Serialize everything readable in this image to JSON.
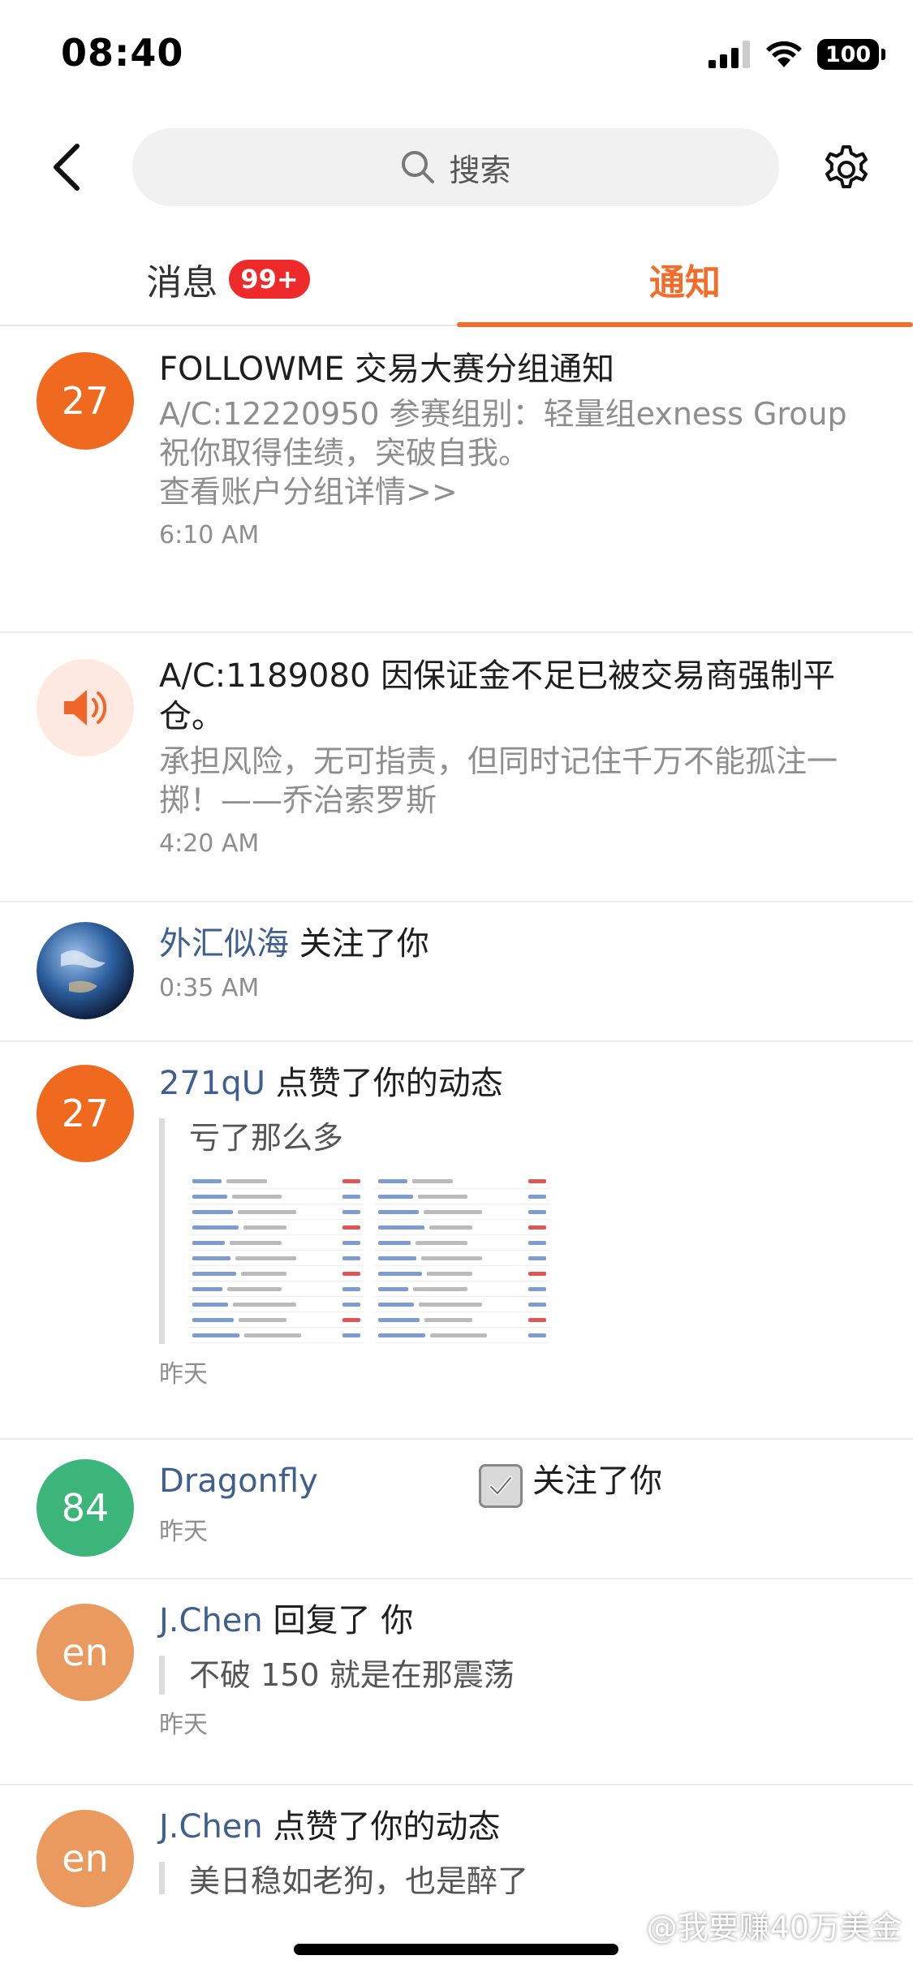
{
  "status_bar": {
    "time": "08:40",
    "battery": "100"
  },
  "header": {
    "search_placeholder": "搜索"
  },
  "tabs": [
    {
      "label": "消息",
      "badge": "99+"
    },
    {
      "label": "通知",
      "active": true
    }
  ],
  "notifications": [
    {
      "avatar_text": "27",
      "avatar_color": "#ef6a1f",
      "title": "FOLLOWME 交易大赛分组通知",
      "desc_lines": [
        "A/C:12220950 参赛组别：轻量组exness Group",
        "祝你取得佳绩，突破自我。",
        "查看账户分组详情>>"
      ],
      "time": "6:10 AM"
    },
    {
      "avatar_icon": "speaker-icon",
      "avatar_color": "#fde9e0",
      "title": "A/C:1189080  因保证金不足已被交易商强制平仓。",
      "desc": "承担风险，无可指责，但同时记住千万不能孤注一掷！——乔治索罗斯",
      "time": "4:20 AM"
    },
    {
      "avatar_icon": "earth-icon",
      "user": "外汇似海",
      "action": " 关注了你",
      "time": "0:35 AM"
    },
    {
      "avatar_text": "27",
      "avatar_color": "#ef6a1f",
      "user": "271qU",
      "action": " 点赞了你的动态",
      "quote": "亏了那么多",
      "time": "昨天"
    },
    {
      "avatar_text": "84",
      "avatar_color": "#3cb57a",
      "user": "Dragonfly",
      "action": "关注了你",
      "time": "昨天"
    },
    {
      "avatar_text": "en",
      "avatar_color": "#ea9a5f",
      "user": "J.Chen",
      "action": " 回复了 你",
      "quote": "不破 150 就是在那震荡",
      "time": "昨天"
    },
    {
      "avatar_text": "en",
      "avatar_color": "#ea9a5f",
      "user": "J.Chen",
      "action": " 点赞了你的动态",
      "quote": "美日稳如老狗，也是醉了"
    }
  ],
  "watermark": "@我要赚40万美金"
}
